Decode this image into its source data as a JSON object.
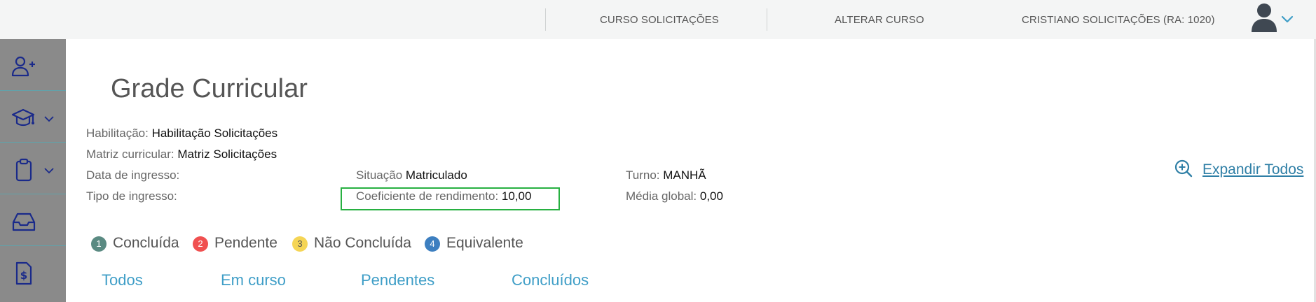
{
  "header": {
    "nav": [
      "CURSO SOLICITAÇÕES",
      "ALTERAR CURSO",
      "CRISTIANO SOLICITAÇÕES (RA: 1020)"
    ],
    "avatar_icon": "user-avatar-icon",
    "menu_icon": "chevron-down-icon"
  },
  "sidebar": {
    "items": [
      {
        "icon": "add-user-icon",
        "has_submenu": false
      },
      {
        "icon": "graduation-cap-icon",
        "has_submenu": true
      },
      {
        "icon": "clipboard-icon",
        "has_submenu": true
      },
      {
        "icon": "inbox-icon",
        "has_submenu": false
      },
      {
        "icon": "dollar-document-icon",
        "has_submenu": false
      }
    ]
  },
  "page": {
    "title": "Grade Curricular"
  },
  "info": {
    "habilitacao_label": "Habilitação:",
    "habilitacao_value": "Habilitação Solicitações",
    "matriz_label": "Matriz curricular:",
    "matriz_value": "Matriz Solicitações",
    "data_ingresso_label": "Data de ingresso:",
    "tipo_ingresso_label": "Tipo de ingresso:",
    "situacao_label": "Situação",
    "situacao_value": "Matriculado",
    "coeficiente_label": "Coeficiente de rendimento:",
    "coeficiente_value": "10,00",
    "turno_label": "Turno:",
    "turno_value": "MANHÃ",
    "media_label": "Média global:",
    "media_value": "0,00"
  },
  "expand": {
    "label": " Expandir Todos",
    "icon": "zoom-in-icon"
  },
  "legend": [
    {
      "num": "1",
      "label": "Concluída",
      "color": "#5a8a82",
      "text_color": "#ffffff"
    },
    {
      "num": "2",
      "label": "Pendente",
      "color": "#f05050",
      "text_color": "#ffffff"
    },
    {
      "num": "3",
      "label": "Não Concluída",
      "color": "#f5d555",
      "text_color": "#555555"
    },
    {
      "num": "4",
      "label": "Equivalente",
      "color": "#3d7fc0",
      "text_color": "#ffffff"
    }
  ],
  "tabs": [
    "Todos",
    "Em curso",
    "Pendentes",
    "Concluídos"
  ],
  "colors": {
    "accent": "#3f9ec7",
    "link": "#2f7fa6",
    "sidebar": "#8a8a8a",
    "sidebar_icons": "#1a2a8a",
    "highlight": "#27b041"
  }
}
